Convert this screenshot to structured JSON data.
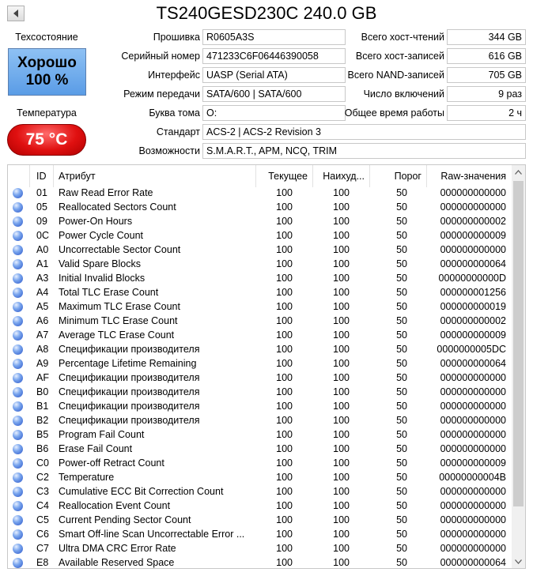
{
  "title": "TS240GESD230C 240.0 GB",
  "health": {
    "label": "Техсостояние",
    "status": "Хорошо",
    "percent": "100 %"
  },
  "temperature": {
    "label": "Температура",
    "value": "75 °C"
  },
  "info": {
    "firmware": {
      "label": "Прошивка",
      "value": "R0605A3S"
    },
    "serial": {
      "label": "Серийный номер",
      "value": "471233C6F06446390058"
    },
    "interface": {
      "label": "Интерфейс",
      "value": "UASP (Serial ATA)"
    },
    "transfer": {
      "label": "Режим передачи",
      "value": "SATA/600 | SATA/600"
    },
    "drive_letter": {
      "label": "Буква тома",
      "value": "O:"
    },
    "standard": {
      "label": "Стандарт",
      "value": "ACS-2 | ACS-2 Revision 3"
    },
    "features": {
      "label": "Возможности",
      "value": "S.M.A.R.T., APM, NCQ, TRIM"
    },
    "host_reads": {
      "label": "Всего хост-чтений",
      "value": "344 GB"
    },
    "host_writes": {
      "label": "Всего хост-записей",
      "value": "616 GB"
    },
    "nand_writes": {
      "label": "Всего NAND-записей",
      "value": "705 GB"
    },
    "power_count": {
      "label": "Число включений",
      "value": "9 раз"
    },
    "power_hours": {
      "label": "Общее время работы",
      "value": "2 ч"
    }
  },
  "table": {
    "headers": {
      "id": "ID",
      "attr": "Атрибут",
      "current": "Текущее",
      "worst": "Наихуд...",
      "threshold": "Порог",
      "raw": "Raw-значения"
    },
    "rows": [
      {
        "id": "01",
        "attr": "Raw Read Error Rate",
        "cur": "100",
        "worst": "100",
        "thr": "50",
        "raw": "000000000000"
      },
      {
        "id": "05",
        "attr": "Reallocated Sectors Count",
        "cur": "100",
        "worst": "100",
        "thr": "50",
        "raw": "000000000000"
      },
      {
        "id": "09",
        "attr": "Power-On Hours",
        "cur": "100",
        "worst": "100",
        "thr": "50",
        "raw": "000000000002"
      },
      {
        "id": "0C",
        "attr": "Power Cycle Count",
        "cur": "100",
        "worst": "100",
        "thr": "50",
        "raw": "000000000009"
      },
      {
        "id": "A0",
        "attr": "Uncorrectable Sector Count",
        "cur": "100",
        "worst": "100",
        "thr": "50",
        "raw": "000000000000"
      },
      {
        "id": "A1",
        "attr": "Valid Spare Blocks",
        "cur": "100",
        "worst": "100",
        "thr": "50",
        "raw": "000000000064"
      },
      {
        "id": "A3",
        "attr": "Initial Invalid Blocks",
        "cur": "100",
        "worst": "100",
        "thr": "50",
        "raw": "00000000000D"
      },
      {
        "id": "A4",
        "attr": "Total TLC Erase Count",
        "cur": "100",
        "worst": "100",
        "thr": "50",
        "raw": "000000001256"
      },
      {
        "id": "A5",
        "attr": "Maximum TLC Erase Count",
        "cur": "100",
        "worst": "100",
        "thr": "50",
        "raw": "000000000019"
      },
      {
        "id": "A6",
        "attr": "Minimum TLC Erase Count",
        "cur": "100",
        "worst": "100",
        "thr": "50",
        "raw": "000000000002"
      },
      {
        "id": "A7",
        "attr": "Average TLC Erase Count",
        "cur": "100",
        "worst": "100",
        "thr": "50",
        "raw": "000000000009"
      },
      {
        "id": "A8",
        "attr": "Спецификации производителя",
        "cur": "100",
        "worst": "100",
        "thr": "50",
        "raw": "0000000005DC"
      },
      {
        "id": "A9",
        "attr": "Percentage Lifetime Remaining",
        "cur": "100",
        "worst": "100",
        "thr": "50",
        "raw": "000000000064"
      },
      {
        "id": "AF",
        "attr": "Спецификации производителя",
        "cur": "100",
        "worst": "100",
        "thr": "50",
        "raw": "000000000000"
      },
      {
        "id": "B0",
        "attr": "Спецификации производителя",
        "cur": "100",
        "worst": "100",
        "thr": "50",
        "raw": "000000000000"
      },
      {
        "id": "B1",
        "attr": "Спецификации производителя",
        "cur": "100",
        "worst": "100",
        "thr": "50",
        "raw": "000000000000"
      },
      {
        "id": "B2",
        "attr": "Спецификации производителя",
        "cur": "100",
        "worst": "100",
        "thr": "50",
        "raw": "000000000000"
      },
      {
        "id": "B5",
        "attr": "Program Fail Count",
        "cur": "100",
        "worst": "100",
        "thr": "50",
        "raw": "000000000000"
      },
      {
        "id": "B6",
        "attr": "Erase Fail Count",
        "cur": "100",
        "worst": "100",
        "thr": "50",
        "raw": "000000000000"
      },
      {
        "id": "C0",
        "attr": "Power-off Retract Count",
        "cur": "100",
        "worst": "100",
        "thr": "50",
        "raw": "000000000009"
      },
      {
        "id": "C2",
        "attr": "Temperature",
        "cur": "100",
        "worst": "100",
        "thr": "50",
        "raw": "00000000004B"
      },
      {
        "id": "C3",
        "attr": "Cumulative ECC Bit Correction Count",
        "cur": "100",
        "worst": "100",
        "thr": "50",
        "raw": "000000000000"
      },
      {
        "id": "C4",
        "attr": "Reallocation Event Count",
        "cur": "100",
        "worst": "100",
        "thr": "50",
        "raw": "000000000000"
      },
      {
        "id": "C5",
        "attr": "Current Pending Sector Count",
        "cur": "100",
        "worst": "100",
        "thr": "50",
        "raw": "000000000000"
      },
      {
        "id": "C6",
        "attr": "Smart Off-line Scan Uncorrectable Error ...",
        "cur": "100",
        "worst": "100",
        "thr": "50",
        "raw": "000000000000"
      },
      {
        "id": "C7",
        "attr": "Ultra DMA CRC Error Rate",
        "cur": "100",
        "worst": "100",
        "thr": "50",
        "raw": "000000000000"
      },
      {
        "id": "E8",
        "attr": "Available Reserved Space",
        "cur": "100",
        "worst": "100",
        "thr": "50",
        "raw": "000000000064"
      }
    ]
  },
  "icons": {
    "back": "back-arrow-icon",
    "status": "status-dot-icon",
    "scroll_up": "scroll-up-icon",
    "scroll_down": "scroll-down-icon"
  },
  "colors": {
    "health": "#6aa8ec",
    "temperature": "#e01010",
    "status_dot": "#3a66d6"
  }
}
